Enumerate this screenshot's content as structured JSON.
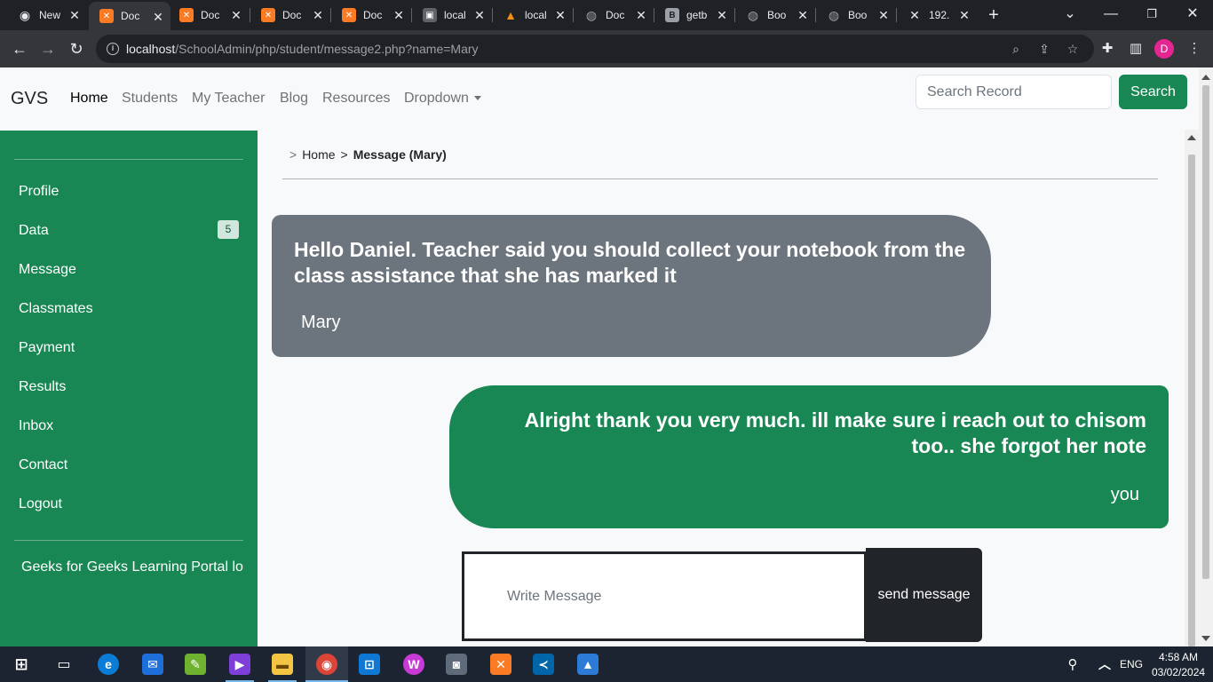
{
  "browser": {
    "tabs": [
      {
        "title": "New",
        "favicon": "chrome-icon",
        "color": "#e8eaed",
        "active": false
      },
      {
        "title": "Doc",
        "favicon": "xampp-icon",
        "color": "#fb7a24",
        "active": true
      },
      {
        "title": "Doc",
        "favicon": "xampp-icon",
        "color": "#fb7a24",
        "active": false
      },
      {
        "title": "Doc",
        "favicon": "xampp-icon",
        "color": "#fb7a24",
        "active": false
      },
      {
        "title": "Doc",
        "favicon": "xampp-icon",
        "color": "#fb7a24",
        "active": false
      },
      {
        "title": "local",
        "favicon": "phpmyadmin-icon",
        "color": "#9aa0a6",
        "active": false
      },
      {
        "title": "local",
        "favicon": "sail-icon",
        "color": "#f29111",
        "active": false
      },
      {
        "title": "Doc",
        "favicon": "globe-icon",
        "color": "#9aa0a6",
        "active": false
      },
      {
        "title": "getb",
        "favicon": "bootstrap-icon",
        "color": "#9aa0a6",
        "active": false
      },
      {
        "title": "Boo",
        "favicon": "globe-icon",
        "color": "#9aa0a6",
        "active": false
      },
      {
        "title": "Boo",
        "favicon": "globe-icon",
        "color": "#9aa0a6",
        "active": false
      },
      {
        "title": "192.",
        "favicon": "x-icon",
        "color": "#e8eaed",
        "active": false
      }
    ],
    "url_host": "localhost",
    "url_path": "/SchoolAdmin/php/student/message2.php?name=Mary",
    "profile_initial": "D"
  },
  "navbar": {
    "brand": "GVS",
    "links": [
      "Home",
      "Students",
      "My Teacher",
      "Blog",
      "Resources",
      "Dropdown"
    ],
    "search_placeholder": "Search Record",
    "search_button": "Search"
  },
  "sidebar": {
    "items": [
      {
        "label": "Profile"
      },
      {
        "label": "Data",
        "badge": "5"
      },
      {
        "label": "Message"
      },
      {
        "label": "Classmates"
      },
      {
        "label": "Payment"
      },
      {
        "label": "Results"
      },
      {
        "label": "Inbox"
      },
      {
        "label": "Contact"
      },
      {
        "label": "Logout"
      }
    ],
    "footer": "Geeks for Geeks Learning Portal lo"
  },
  "breadcrumb": {
    "prefix": ">",
    "home": "Home",
    "separator": ">",
    "current": "Message (Mary)"
  },
  "messages": [
    {
      "text": "Hello Daniel. Teacher said you should collect your notebook from the class assistance that she has marked it",
      "sender": "Mary",
      "direction": "incoming"
    },
    {
      "text": "Alright thank you very much. ill make sure i reach out to chisom too.. she forgot her note",
      "sender": "you",
      "direction": "outgoing"
    }
  ],
  "compose": {
    "placeholder": "Write Message",
    "send_label": "send message"
  },
  "taskbar": {
    "language": "ENG",
    "time": "4:58 AM",
    "date": "03/02/2024"
  },
  "colors": {
    "primary_green": "#198754",
    "incoming_gray": "#6c757d",
    "dark": "#212529"
  }
}
